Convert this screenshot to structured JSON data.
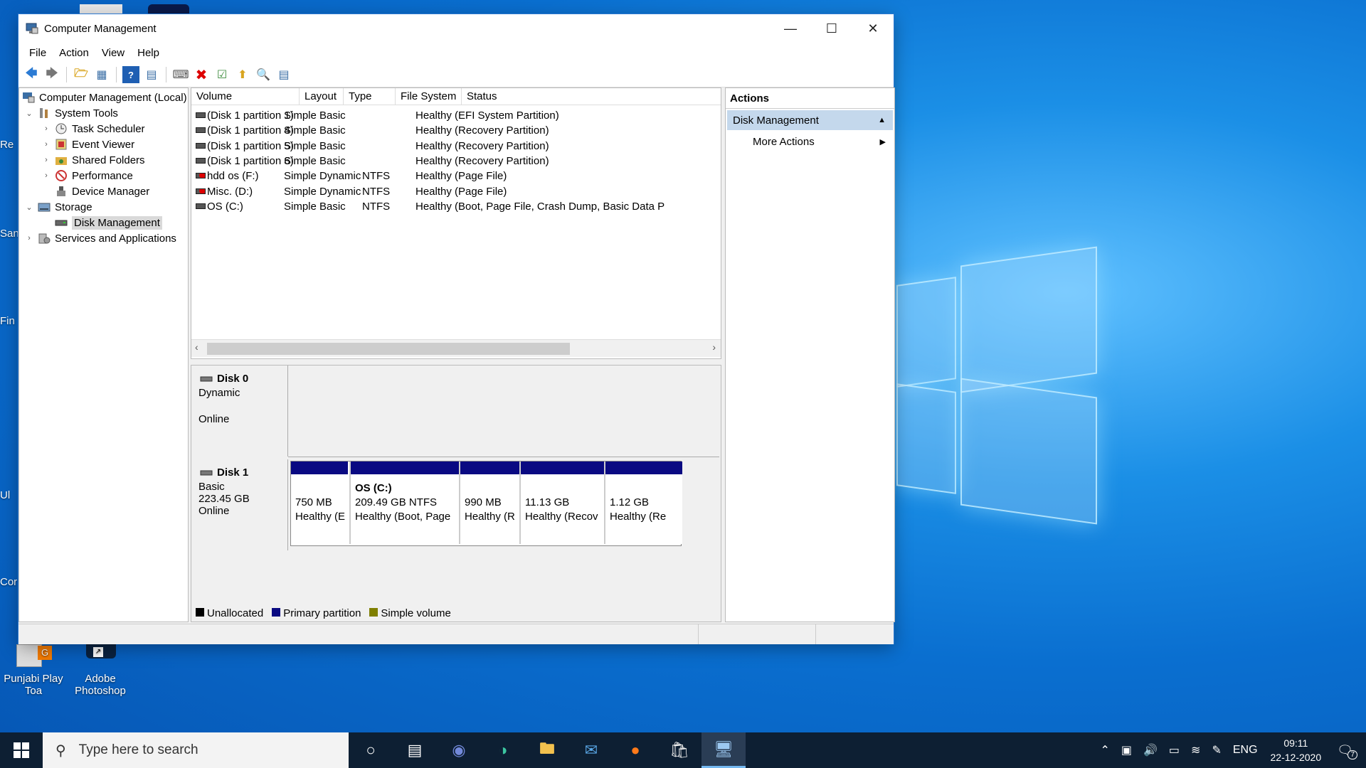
{
  "window": {
    "title": "Computer Management",
    "menu": [
      "File",
      "Action",
      "View",
      "Help"
    ]
  },
  "tree": {
    "root": "Computer Management (Local)",
    "system_tools": "System Tools",
    "task_scheduler": "Task Scheduler",
    "event_viewer": "Event Viewer",
    "shared_folders": "Shared Folders",
    "performance": "Performance",
    "device_manager": "Device Manager",
    "storage": "Storage",
    "disk_management": "Disk Management",
    "services": "Services and Applications"
  },
  "volume_table": {
    "headers": [
      "Volume",
      "Layout",
      "Type",
      "File System",
      "Status"
    ],
    "rows": [
      {
        "volume": "(Disk 1 partition 1)",
        "layout": "Simple",
        "type": "Basic",
        "fs": "",
        "status": "Healthy (EFI System Partition)"
      },
      {
        "volume": "(Disk 1 partition 4)",
        "layout": "Simple",
        "type": "Basic",
        "fs": "",
        "status": "Healthy (Recovery Partition)"
      },
      {
        "volume": "(Disk 1 partition 5)",
        "layout": "Simple",
        "type": "Basic",
        "fs": "",
        "status": "Healthy (Recovery Partition)"
      },
      {
        "volume": "(Disk 1 partition 6)",
        "layout": "Simple",
        "type": "Basic",
        "fs": "",
        "status": "Healthy (Recovery Partition)"
      },
      {
        "volume": "hdd os (F:)",
        "layout": "Simple",
        "type": "Dynamic",
        "fs": "NTFS",
        "status": "Healthy (Page File)"
      },
      {
        "volume": "Misc. (D:)",
        "layout": "Simple",
        "type": "Dynamic",
        "fs": "NTFS",
        "status": "Healthy (Page File)"
      },
      {
        "volume": "OS (C:)",
        "layout": "Simple",
        "type": "Basic",
        "fs": "NTFS",
        "status": "Healthy (Boot, Page File, Crash Dump, Basic Data Parti"
      }
    ]
  },
  "disks": {
    "disk0": {
      "name": "Disk 0",
      "type": "Dynamic",
      "state": "Online"
    },
    "disk1": {
      "name": "Disk 1",
      "type": "Basic",
      "size": "223.45 GB",
      "state": "Online",
      "partitions": [
        {
          "title": "",
          "size": "750 MB",
          "status": "Healthy (E"
        },
        {
          "title": "OS  (C:)",
          "size": "209.49 GB NTFS",
          "status": "Healthy (Boot, Page"
        },
        {
          "title": "",
          "size": "990 MB",
          "status": "Healthy (R"
        },
        {
          "title": "",
          "size": "11.13 GB",
          "status": "Healthy (Recov"
        },
        {
          "title": "",
          "size": "1.12 GB",
          "status": "Healthy (Re"
        }
      ]
    }
  },
  "legend": [
    {
      "label": "Unallocated",
      "color": "#000000"
    },
    {
      "label": "Primary partition",
      "color": "#0a0a82"
    },
    {
      "label": "Simple volume",
      "color": "#7f7f00"
    }
  ],
  "actions": {
    "header": "Actions",
    "section": "Disk Management",
    "more": "More Actions"
  },
  "desktop": {
    "edge_labels": [
      "Re",
      "San",
      "Fin",
      "Ul",
      "Cor"
    ],
    "icons": [
      {
        "label_line1": "Punjabi Play",
        "label_line2": "Toa"
      },
      {
        "label_line1": "Adobe",
        "label_line2": "Photoshop"
      }
    ]
  },
  "taskbar": {
    "search_placeholder": "Type here to search",
    "language": "ENG",
    "time": "09:11",
    "date": "22-12-2020",
    "notification_count": "7"
  }
}
